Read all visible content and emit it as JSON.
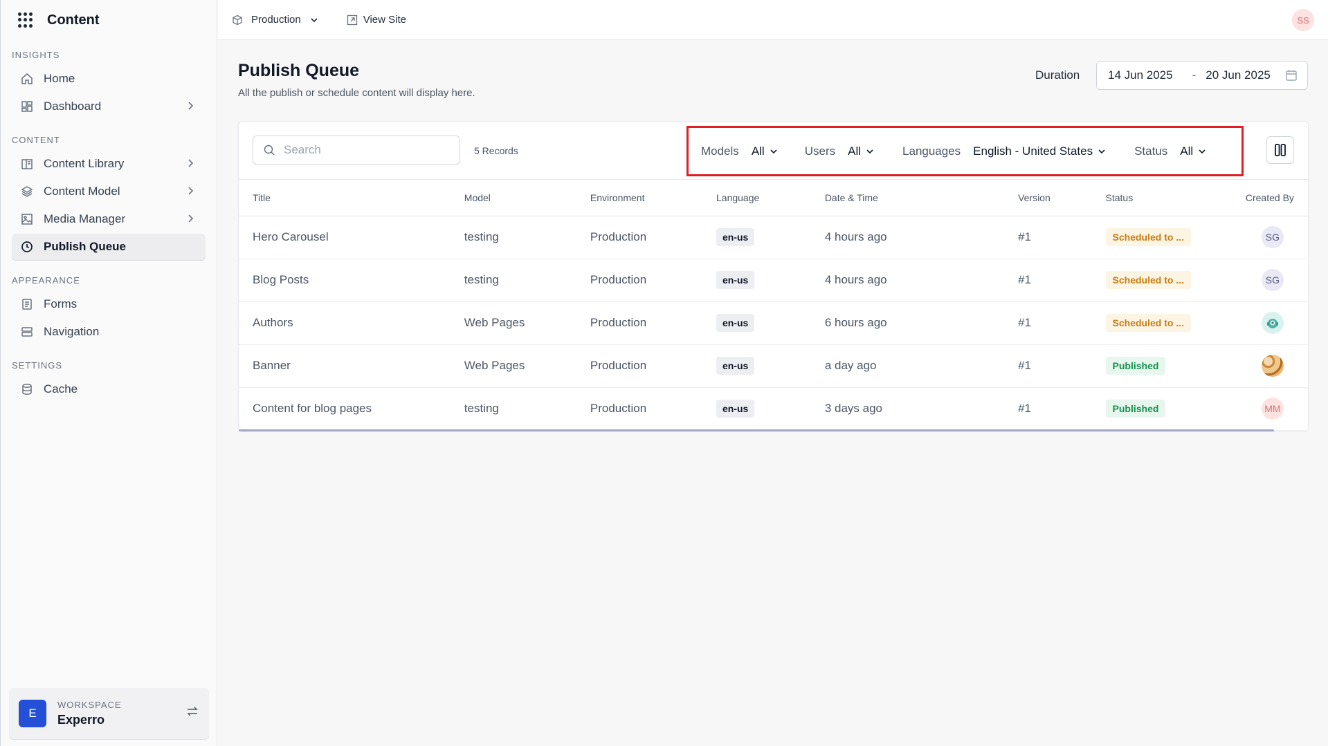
{
  "sidebar": {
    "app_name": "Content",
    "sections": [
      {
        "label": "INSIGHTS"
      },
      {
        "label": "CONTENT"
      },
      {
        "label": "APPEARANCE"
      },
      {
        "label": "SETTINGS"
      }
    ],
    "items": {
      "home": "Home",
      "dashboard": "Dashboard",
      "content_library": "Content Library",
      "content_model": "Content Model",
      "media_manager": "Media Manager",
      "publish_queue": "Publish Queue",
      "forms": "Forms",
      "navigation": "Navigation",
      "cache": "Cache"
    },
    "active_item": "Publish Queue",
    "workspace": {
      "label": "WORKSPACE",
      "name": "Experro",
      "initial": "E"
    }
  },
  "topbar": {
    "environment": "Production",
    "view_site": "View Site",
    "user_initials": "SS"
  },
  "header": {
    "title": "Publish Queue",
    "subtitle": "All the publish or schedule content will display here.",
    "duration_label": "Duration",
    "date_from": "14 Jun 2025",
    "date_sep": "-",
    "date_to": "20 Jun 2025"
  },
  "toolbar": {
    "search_placeholder": "Search",
    "records": "5 Records",
    "filters": {
      "models_label": "Models",
      "models_value": "All",
      "users_label": "Users",
      "users_value": "All",
      "languages_label": "Languages",
      "languages_value": "English - United States",
      "status_label": "Status",
      "status_value": "All"
    }
  },
  "table": {
    "columns": [
      "Title",
      "Model",
      "Environment",
      "Language",
      "Date & Time",
      "Version",
      "Status",
      "Created By"
    ],
    "rows": [
      {
        "title": "Hero Carousel",
        "model": "testing",
        "environment": "Production",
        "language": "en-us",
        "datetime": "4 hours ago",
        "version": "#1",
        "status": "Scheduled to ...",
        "created_by": "SG"
      },
      {
        "title": "Blog Posts",
        "model": "testing",
        "environment": "Production",
        "language": "en-us",
        "datetime": "4 hours ago",
        "version": "#1",
        "status": "Scheduled to ...",
        "created_by": "SG"
      },
      {
        "title": "Authors",
        "model": "Web Pages",
        "environment": "Production",
        "language": "en-us",
        "datetime": "6 hours ago",
        "version": "#1",
        "status": "Scheduled to ...",
        "created_by": ""
      },
      {
        "title": "Banner",
        "model": "Web Pages",
        "environment": "Production",
        "language": "en-us",
        "datetime": "a day ago",
        "version": "#1",
        "status": "Published",
        "created_by": ""
      },
      {
        "title": "Content for blog pages",
        "model": "testing",
        "environment": "Production",
        "language": "en-us",
        "datetime": "3 days ago",
        "version": "#1",
        "status": "Published",
        "created_by": "MM"
      }
    ]
  },
  "colors": {
    "accent": "#2450d8",
    "highlight_border": "#e11d24",
    "scheduled": "#c77d10",
    "published": "#16914f"
  }
}
